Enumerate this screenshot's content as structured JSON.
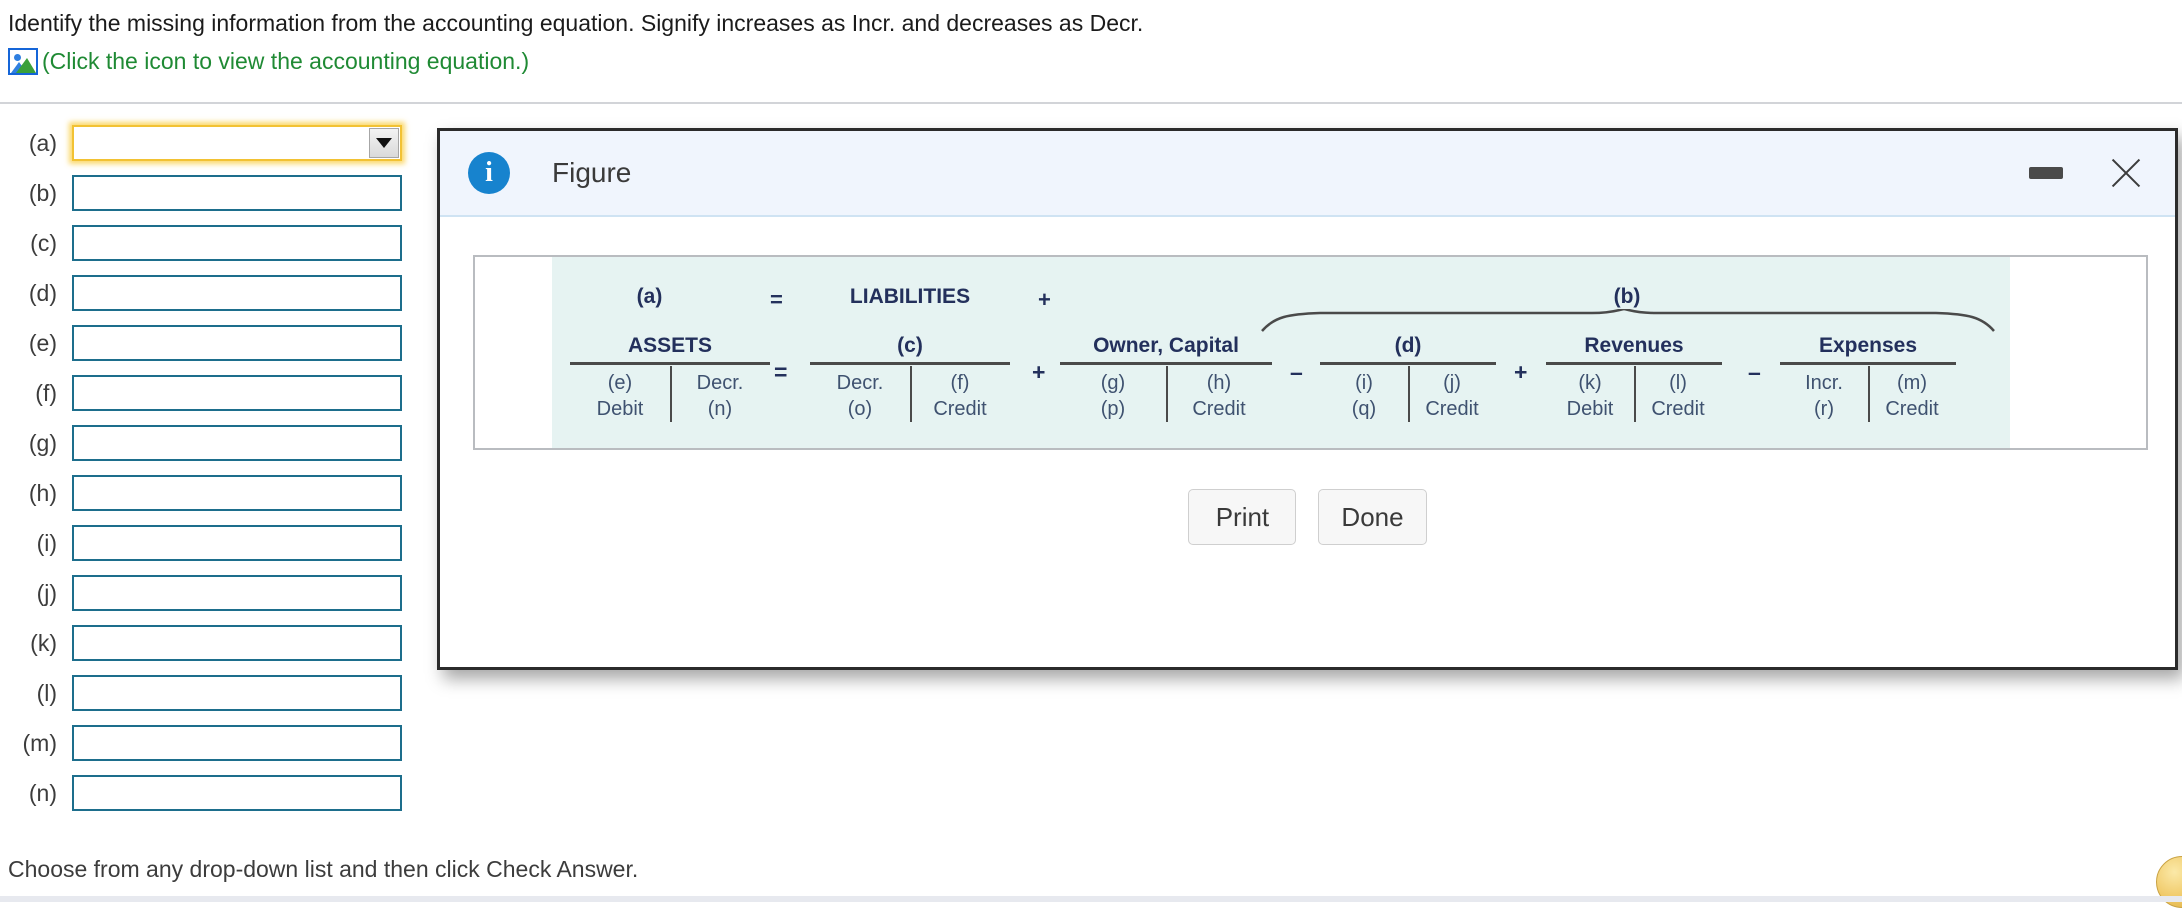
{
  "question": {
    "prompt": "Identify the missing information from the accounting equation. Signify increases as Incr. and decreases as Decr.",
    "figure_link_text": "(Click the icon to view the accounting equation.)",
    "figure_icon": "image-icon"
  },
  "answers": {
    "rows": [
      {
        "label": "(a)",
        "value": "",
        "type": "dropdown",
        "focused": true
      },
      {
        "label": "(b)",
        "value": "",
        "type": "dropdown",
        "focused": false
      },
      {
        "label": "(c)",
        "value": "",
        "type": "dropdown",
        "focused": false
      },
      {
        "label": "(d)",
        "value": "",
        "type": "dropdown",
        "focused": false
      },
      {
        "label": "(e)",
        "value": "",
        "type": "dropdown",
        "focused": false
      },
      {
        "label": "(f)",
        "value": "",
        "type": "dropdown",
        "focused": false
      },
      {
        "label": "(g)",
        "value": "",
        "type": "dropdown",
        "focused": false
      },
      {
        "label": "(h)",
        "value": "",
        "type": "dropdown",
        "focused": false
      },
      {
        "label": "(i)",
        "value": "",
        "type": "dropdown",
        "focused": false
      },
      {
        "label": "(j)",
        "value": "",
        "type": "dropdown",
        "focused": false
      },
      {
        "label": "(k)",
        "value": "",
        "type": "dropdown",
        "focused": false
      },
      {
        "label": "(l)",
        "value": "",
        "type": "dropdown",
        "focused": false
      },
      {
        "label": "(m)",
        "value": "",
        "type": "dropdown",
        "focused": false
      },
      {
        "label": "(n)",
        "value": "",
        "type": "dropdown",
        "focused": false
      }
    ]
  },
  "footer": {
    "instruction": "Choose from any drop-down list and then click Check Answer.",
    "help_badge": "help-badge"
  },
  "dialog": {
    "title": "Figure",
    "info_icon": "info-icon",
    "minimize_label": "minimize-icon",
    "close_label": "close-icon",
    "buttons": {
      "print": "Print",
      "done": "Done"
    },
    "figure": {
      "top_row": {
        "assets_placeholder": "(a)",
        "equals": "=",
        "liabilities": "LIABILITIES",
        "plus": "+",
        "equity_brace_label": "(b)"
      },
      "equals_symbol": "=",
      "accounts": [
        {
          "title": "ASSETS",
          "left": {
            "line1": "(e)",
            "line2": "Debit"
          },
          "right": {
            "line1": "Decr.",
            "line2": "(n)"
          },
          "operator_after": "="
        },
        {
          "title": "(c)",
          "left": {
            "line1": "Decr.",
            "line2": "(o)"
          },
          "right": {
            "line1": "(f)",
            "line2": "Credit"
          },
          "operator_after": "+"
        },
        {
          "title": "Owner, Capital",
          "left": {
            "line1": "(g)",
            "line2": "(p)"
          },
          "right": {
            "line1": "(h)",
            "line2": "Credit"
          },
          "operator_after": "–"
        },
        {
          "title": "(d)",
          "left": {
            "line1": "(i)",
            "line2": "(q)"
          },
          "right": {
            "line1": "(j)",
            "line2": "Credit"
          },
          "operator_after": "+"
        },
        {
          "title": "Revenues",
          "left": {
            "line1": "(k)",
            "line2": "Debit"
          },
          "right": {
            "line1": "(l)",
            "line2": "Credit"
          },
          "operator_after": "–"
        },
        {
          "title": "Expenses",
          "left": {
            "line1": "Incr.",
            "line2": "(r)"
          },
          "right": {
            "line1": "(m)",
            "line2": "Credit"
          },
          "operator_after": ""
        }
      ]
    }
  },
  "colors": {
    "link_green": "#1f8a34",
    "field_border": "#1d6e8c",
    "focus_yellow": "#f2c233",
    "figure_teal_bg": "#e6f3f2",
    "heading_navy": "#23305c",
    "info_blue": "#1783ce"
  }
}
